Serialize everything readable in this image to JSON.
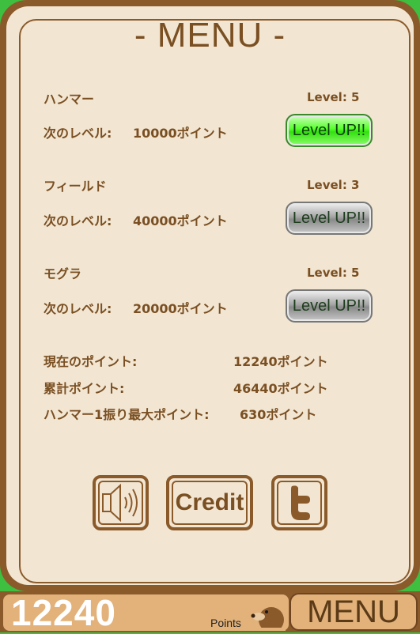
{
  "title": "- MENU -",
  "upgrades": [
    {
      "name": "ハンマー",
      "level": "Level: 5",
      "next_label": "次のレベル:",
      "next_cost": "10000ポイント",
      "button": "Level UP!!",
      "active": true
    },
    {
      "name": "フィールド",
      "level": "Level: 3",
      "next_label": "次のレベル:",
      "next_cost": "40000ポイント",
      "button": "Level UP!!",
      "active": false
    },
    {
      "name": "モグラ",
      "level": "Level: 5",
      "next_label": "次のレベル:",
      "next_cost": "20000ポイント",
      "button": "Level UP!!",
      "active": false
    }
  ],
  "stats": [
    {
      "label": "現在のポイント:",
      "value": "12240ポイント"
    },
    {
      "label": "累計ポイント:",
      "value": "46440ポイント"
    },
    {
      "label": "ハンマー1振り最大ポイント:",
      "value": "630ポイント"
    }
  ],
  "buttons": {
    "sound_icon": "speaker-icon",
    "credit": "Credit",
    "twitter_icon": "twitter-icon"
  },
  "bottom": {
    "score": "12240",
    "points_label": "Points",
    "menu": "MENU",
    "mascot_icon": "mole-icon"
  },
  "colors": {
    "brown": "#8b5a2b",
    "panel": "#f2e6d3",
    "green_bg": "#3fbf3f",
    "active_button": "#33e010"
  }
}
